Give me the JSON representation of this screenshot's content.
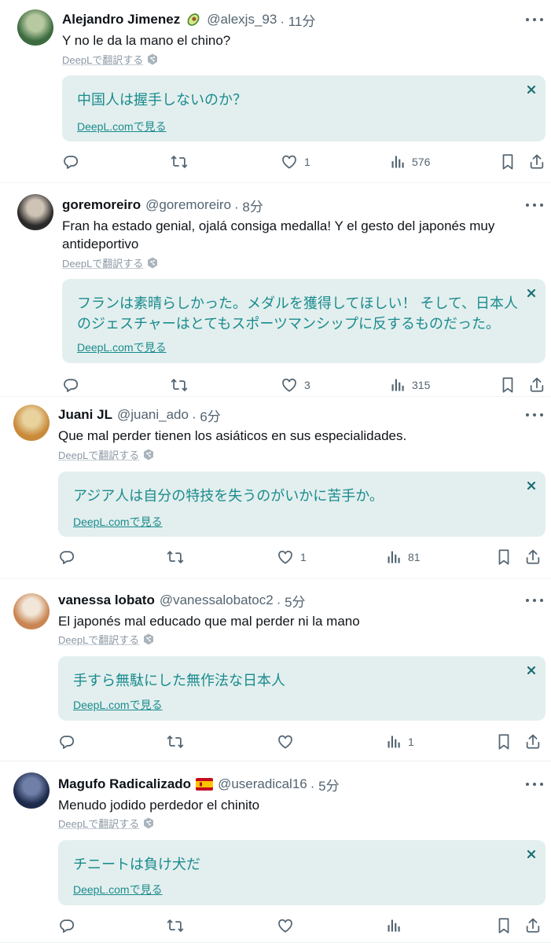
{
  "deepl_translate_label": "DeepLで翻訳する",
  "deepl_view_label": "DeepL.comで見る",
  "tweets": [
    {
      "name": "Alejandro Jimenez",
      "handle": "@alexjs_93",
      "time": "· 11分",
      "badge": "avocado",
      "text": "Y no le da la mano el chino?",
      "translation": "中国人は握手しないのか？",
      "likes": "1",
      "views": "576",
      "avatar_colors": [
        "#3b6b3f",
        "#b7c9a0"
      ]
    },
    {
      "name": "goremoreiro",
      "handle": "@goremoreiro",
      "time": "· 8分",
      "badge": "",
      "text": "Fran ha estado genial, ojalá consiga medalla! Y el gesto del japonés muy antideportivo",
      "translation": "フランは素晴らしかった。メダルを獲得してほしい！ そして、日本人のジェスチャーはとてもスポーツマンシップに反するものだった。",
      "likes": "3",
      "views": "315",
      "avatar_colors": [
        "#2b2a2a",
        "#cfc3b6"
      ]
    },
    {
      "name": "Juani JL",
      "handle": "@juani_ado",
      "time": "· 6分",
      "badge": "",
      "text": "Que mal perder tienen los asiáticos en sus especialidades.",
      "translation": "アジア人は自分の特技を失うのがいかに苦手か。",
      "likes": "1",
      "views": "81",
      "avatar_colors": [
        "#c98a3a",
        "#e9d29e"
      ]
    },
    {
      "name": "vanessa lobato",
      "handle": "@vanessalobatoc2",
      "time": "· 5分",
      "badge": "",
      "text": "El japonés mal educado que mal perder ni la mano",
      "translation": "手すら無駄にした無作法な日本人",
      "likes": "",
      "views": "1",
      "avatar_colors": [
        "#c98552",
        "#f2e6d8"
      ]
    },
    {
      "name": "Magufo Radicalizado",
      "handle": "@useradical16",
      "time": "· 5分",
      "badge": "spain-flag",
      "text": "Menudo jodido perdedor el chinito",
      "translation": "チニートは負け犬だ",
      "likes": "",
      "views": "",
      "avatar_colors": [
        "#1e2a4a",
        "#6f7fa8"
      ]
    }
  ]
}
